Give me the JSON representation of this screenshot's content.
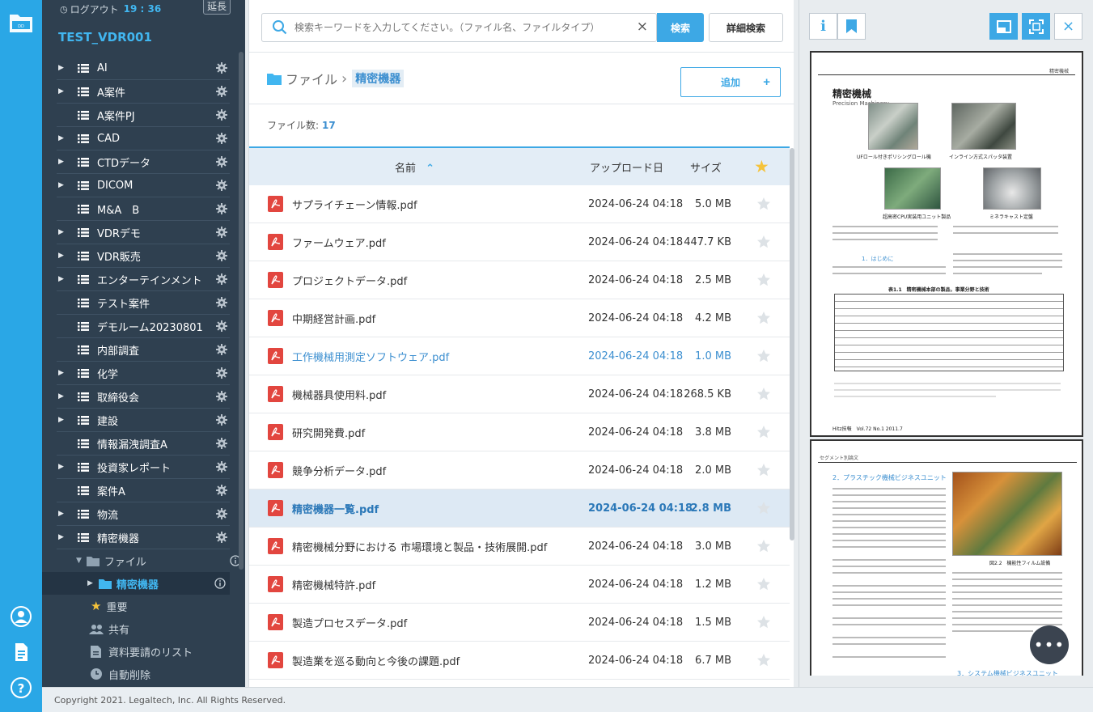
{
  "session": {
    "logout_label": "ログアウト",
    "time": "19 : 36",
    "extend_label": "延長"
  },
  "room_name": "TEST_VDR001",
  "sidebar": {
    "folders": [
      {
        "label": "AI",
        "arrow": true
      },
      {
        "label": "A案件",
        "arrow": true
      },
      {
        "label": "A案件PJ",
        "arrow": false
      },
      {
        "label": "CAD",
        "arrow": true
      },
      {
        "label": "CTDデータ",
        "arrow": true
      },
      {
        "label": "DICOM",
        "arrow": true
      },
      {
        "label": "M&A　B",
        "arrow": false
      },
      {
        "label": "VDRデモ",
        "arrow": true
      },
      {
        "label": "VDR販売",
        "arrow": true
      },
      {
        "label": "エンターテインメント",
        "arrow": true
      },
      {
        "label": "テスト案件",
        "arrow": false
      },
      {
        "label": "デモルーム20230801",
        "arrow": false
      },
      {
        "label": "内部調査",
        "arrow": false
      },
      {
        "label": "化学",
        "arrow": true
      },
      {
        "label": "取締役会",
        "arrow": true
      },
      {
        "label": "建設",
        "arrow": true
      },
      {
        "label": "情報漏洩調査A",
        "arrow": false
      },
      {
        "label": "投資家レポート",
        "arrow": true
      },
      {
        "label": "案件A",
        "arrow": false
      },
      {
        "label": "物流",
        "arrow": true
      },
      {
        "label": "精密機器",
        "arrow": true
      }
    ],
    "subfolder_file": "ファイル",
    "subfolder_active": "精密機器",
    "extras": [
      "重要",
      "共有",
      "資料要請のリスト",
      "自動削除"
    ]
  },
  "search": {
    "placeholder": "検索キーワードを入力してください。（ファイル名、ファイルタイプ）",
    "clear": "×",
    "search_label": "検索",
    "advanced_label": "詳細検索"
  },
  "breadcrumb": {
    "root": "ファイル",
    "sep": "›",
    "current": "精密機器"
  },
  "add_label": "追加",
  "add_plus": "+",
  "file_count_label": "ファイル数:",
  "file_count": "17",
  "table": {
    "col_name": "名前",
    "col_date": "アップロード日",
    "col_size": "サイズ",
    "rows": [
      {
        "name": "サプライチェーン情報.pdf",
        "date": "2024-06-24 04:18",
        "size": "5.0 MB"
      },
      {
        "name": "ファームウェア.pdf",
        "date": "2024-06-24 04:18",
        "size": "447.7 KB"
      },
      {
        "name": "プロジェクトデータ.pdf",
        "date": "2024-06-24 04:18",
        "size": "2.5 MB"
      },
      {
        "name": "中期経営計画.pdf",
        "date": "2024-06-24 04:18",
        "size": "4.2 MB"
      },
      {
        "name": "工作機械用測定ソフトウェア.pdf",
        "date": "2024-06-24 04:18",
        "size": "1.0 MB"
      },
      {
        "name": "機械器具使用料.pdf",
        "date": "2024-06-24 04:18",
        "size": "268.5 KB"
      },
      {
        "name": "研究開発費.pdf",
        "date": "2024-06-24 04:18",
        "size": "3.8 MB"
      },
      {
        "name": "競争分析データ.pdf",
        "date": "2024-06-24 04:18",
        "size": "2.0 MB"
      },
      {
        "name": "精密機器一覧.pdf",
        "date": "2024-06-24 04:18",
        "size": "2.8 MB"
      },
      {
        "name": "精密機械分野における 市場環境と製品・技術展開.pdf",
        "date": "2024-06-24 04:18",
        "size": "3.0 MB"
      },
      {
        "name": "精密機械特許.pdf",
        "date": "2024-06-24 04:18",
        "size": "1.2 MB"
      },
      {
        "name": "製造プロセスデータ.pdf",
        "date": "2024-06-24 04:18",
        "size": "1.5 MB"
      },
      {
        "name": "製造業を巡る動向と今後の課題.pdf",
        "date": "2024-06-24 04:18",
        "size": "6.7 MB"
      }
    ]
  },
  "preview": {
    "info_label": "i",
    "close_label": "×",
    "page1_header": "精密機械",
    "page1_title": "精密機械",
    "page1_subtitle": "Precision Machinery",
    "page1_caption1": "UFロール付きポリシングロール機",
    "page1_caption2": "インライン方式スパッタ装置",
    "page1_caption3": "超高密CPU実装用ユニット製品",
    "page1_caption4": "ミネラキャスト定盤",
    "page1_section": "1．はじめに",
    "page1_table_title": "表1.1　精密機械本部の製品，事業分野と技術",
    "page1_footer": "Hitz技報　Vol.72 No.1 2011.7",
    "page2_header": "セグメント別論文",
    "page2_section": "2．プラスチック機械ビジネスユニット",
    "page2_fig_caption": "図2.2　機能性フィルム設備",
    "page2_section3": "3．システム機械ビジネスユニット",
    "more_label": "•••"
  },
  "footer_text": "Copyright 2021. Legaltech, Inc. All Rights Reserved.",
  "colors": {
    "accent": "#3da8e5",
    "rail": "#2aa7e6",
    "sidebar": "#2f4050",
    "pdf_red": "#e2463f"
  }
}
